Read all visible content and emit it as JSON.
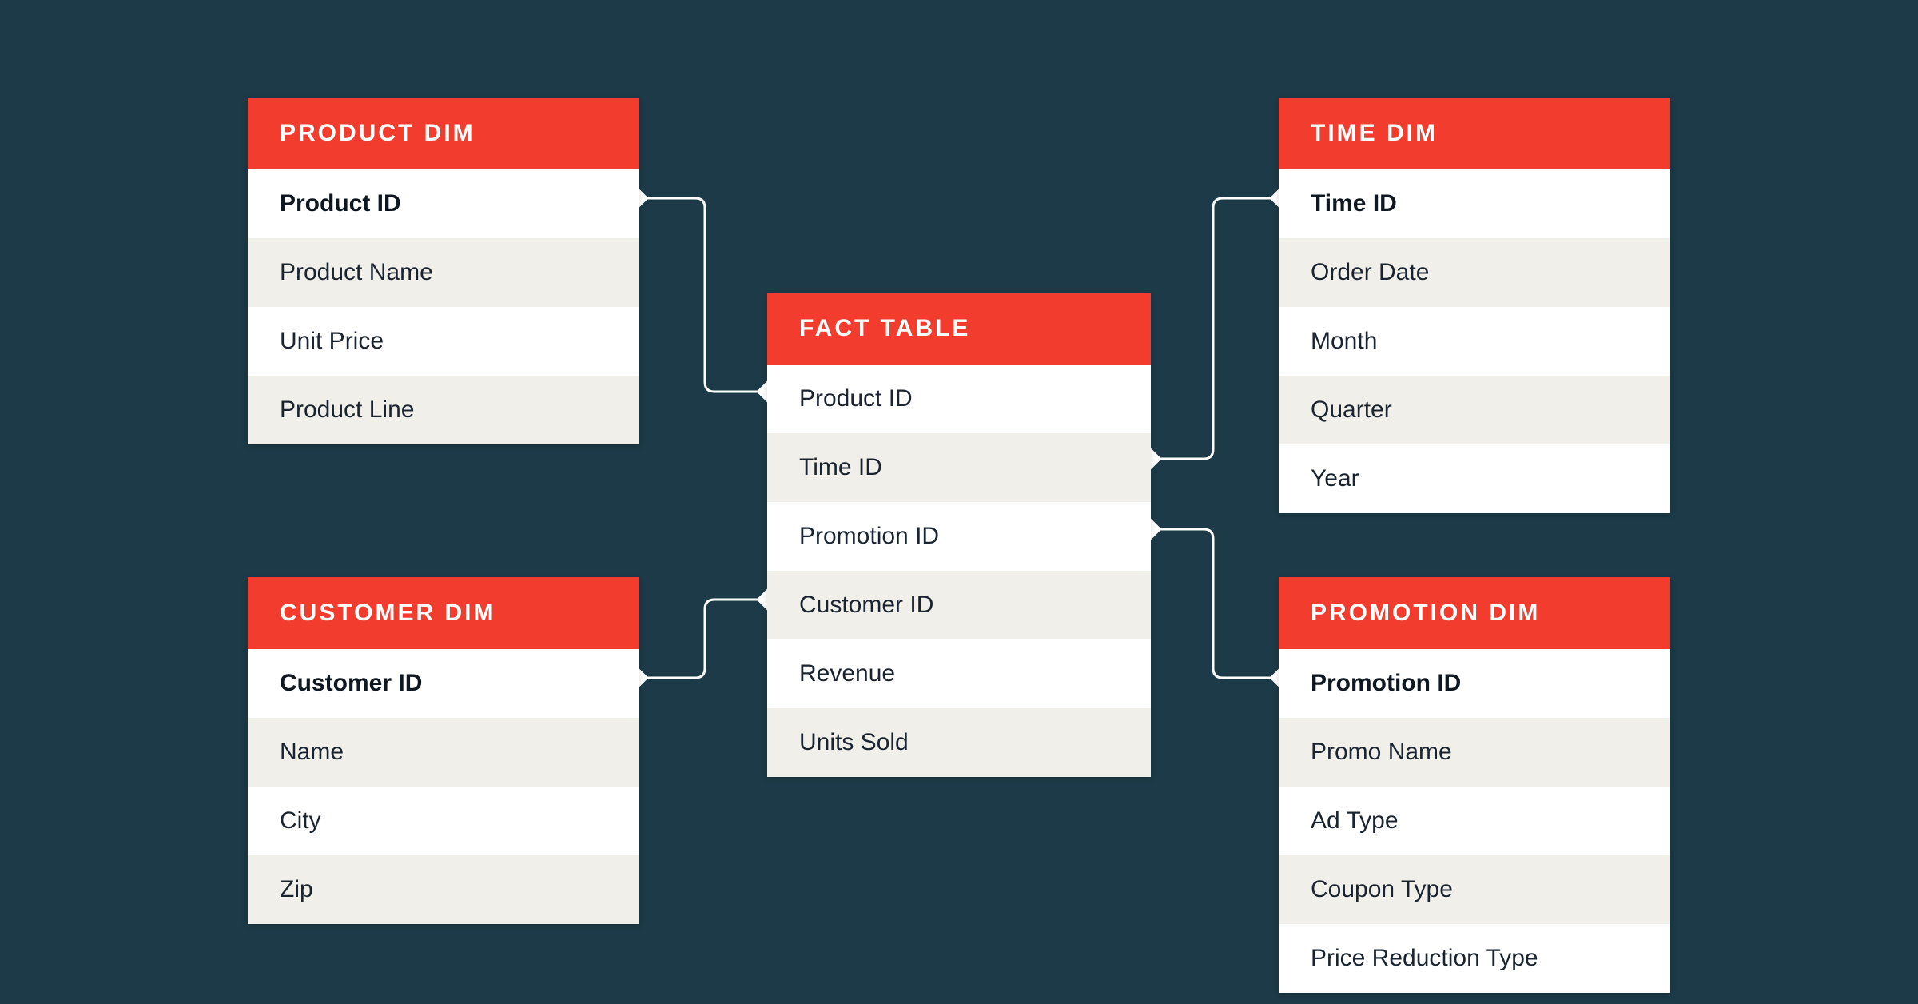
{
  "tables": {
    "product": {
      "title": "PRODUCT DIM",
      "rows": [
        "Product ID",
        "Product Name",
        "Unit Price",
        "Product Line"
      ]
    },
    "customer": {
      "title": "CUSTOMER DIM",
      "rows": [
        "Customer ID",
        "Name",
        "City",
        "Zip"
      ]
    },
    "fact": {
      "title": "FACT TABLE",
      "rows": [
        "Product ID",
        "Time ID",
        "Promotion ID",
        "Customer ID",
        "Revenue",
        "Units Sold"
      ]
    },
    "time": {
      "title": "TIME DIM",
      "rows": [
        "Time ID",
        "Order Date",
        "Month",
        "Quarter",
        "Year"
      ]
    },
    "promotion": {
      "title": "PROMOTION DIM",
      "rows": [
        "Promotion ID",
        "Promo Name",
        "Ad Type",
        "Coupon Type",
        "Price Reduction Type"
      ]
    }
  }
}
